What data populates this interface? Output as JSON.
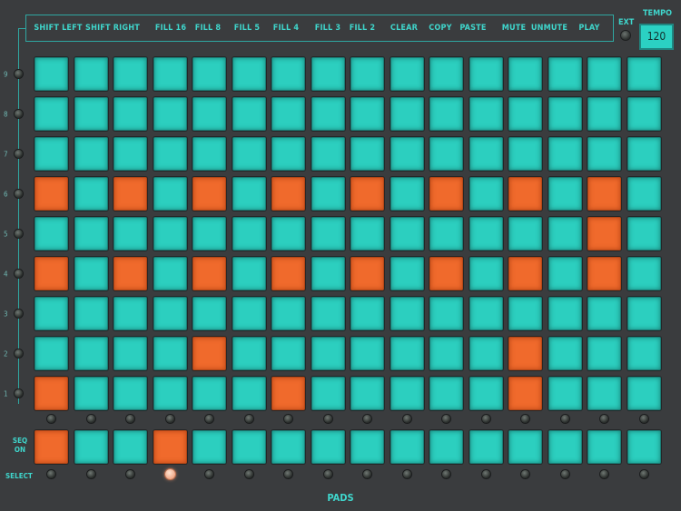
{
  "toolbar": {
    "buttons": [
      "SHIFT LEFT",
      "SHIFT RIGHT",
      "FILL 16",
      "FILL 8",
      "FILL 5",
      "FILL 4",
      "FILL 3",
      "FILL 2",
      "CLEAR",
      "COPY",
      "PASTE",
      "MUTE",
      "UNMUTE",
      "PLAY"
    ],
    "ext_label": "EXT",
    "tempo_label": "TEMPO",
    "tempo_value": "120"
  },
  "grid": {
    "row_numbers": [
      "9",
      "8",
      "7",
      "6",
      "5",
      "4",
      "3",
      "2",
      "1"
    ],
    "columns": 16,
    "active_cells": [
      [],
      [],
      [],
      [
        0,
        2,
        4,
        6,
        8,
        10,
        12,
        14
      ],
      [
        14
      ],
      [
        0,
        2,
        4,
        6,
        8,
        10,
        12,
        14
      ],
      [],
      [
        4,
        12
      ],
      [
        0,
        6,
        12
      ]
    ]
  },
  "sequence": {
    "label_line1": "SEQ",
    "label_line2": "ON",
    "active_pads": [
      0,
      3
    ]
  },
  "select": {
    "label": "SELECT",
    "selected_index": 3
  },
  "title": "PADS",
  "colors": {
    "pad_idle": "#2ccfbf",
    "pad_active": "#f06a2c",
    "accent_text": "#3fd6cc",
    "background": "#3a3c3e"
  }
}
